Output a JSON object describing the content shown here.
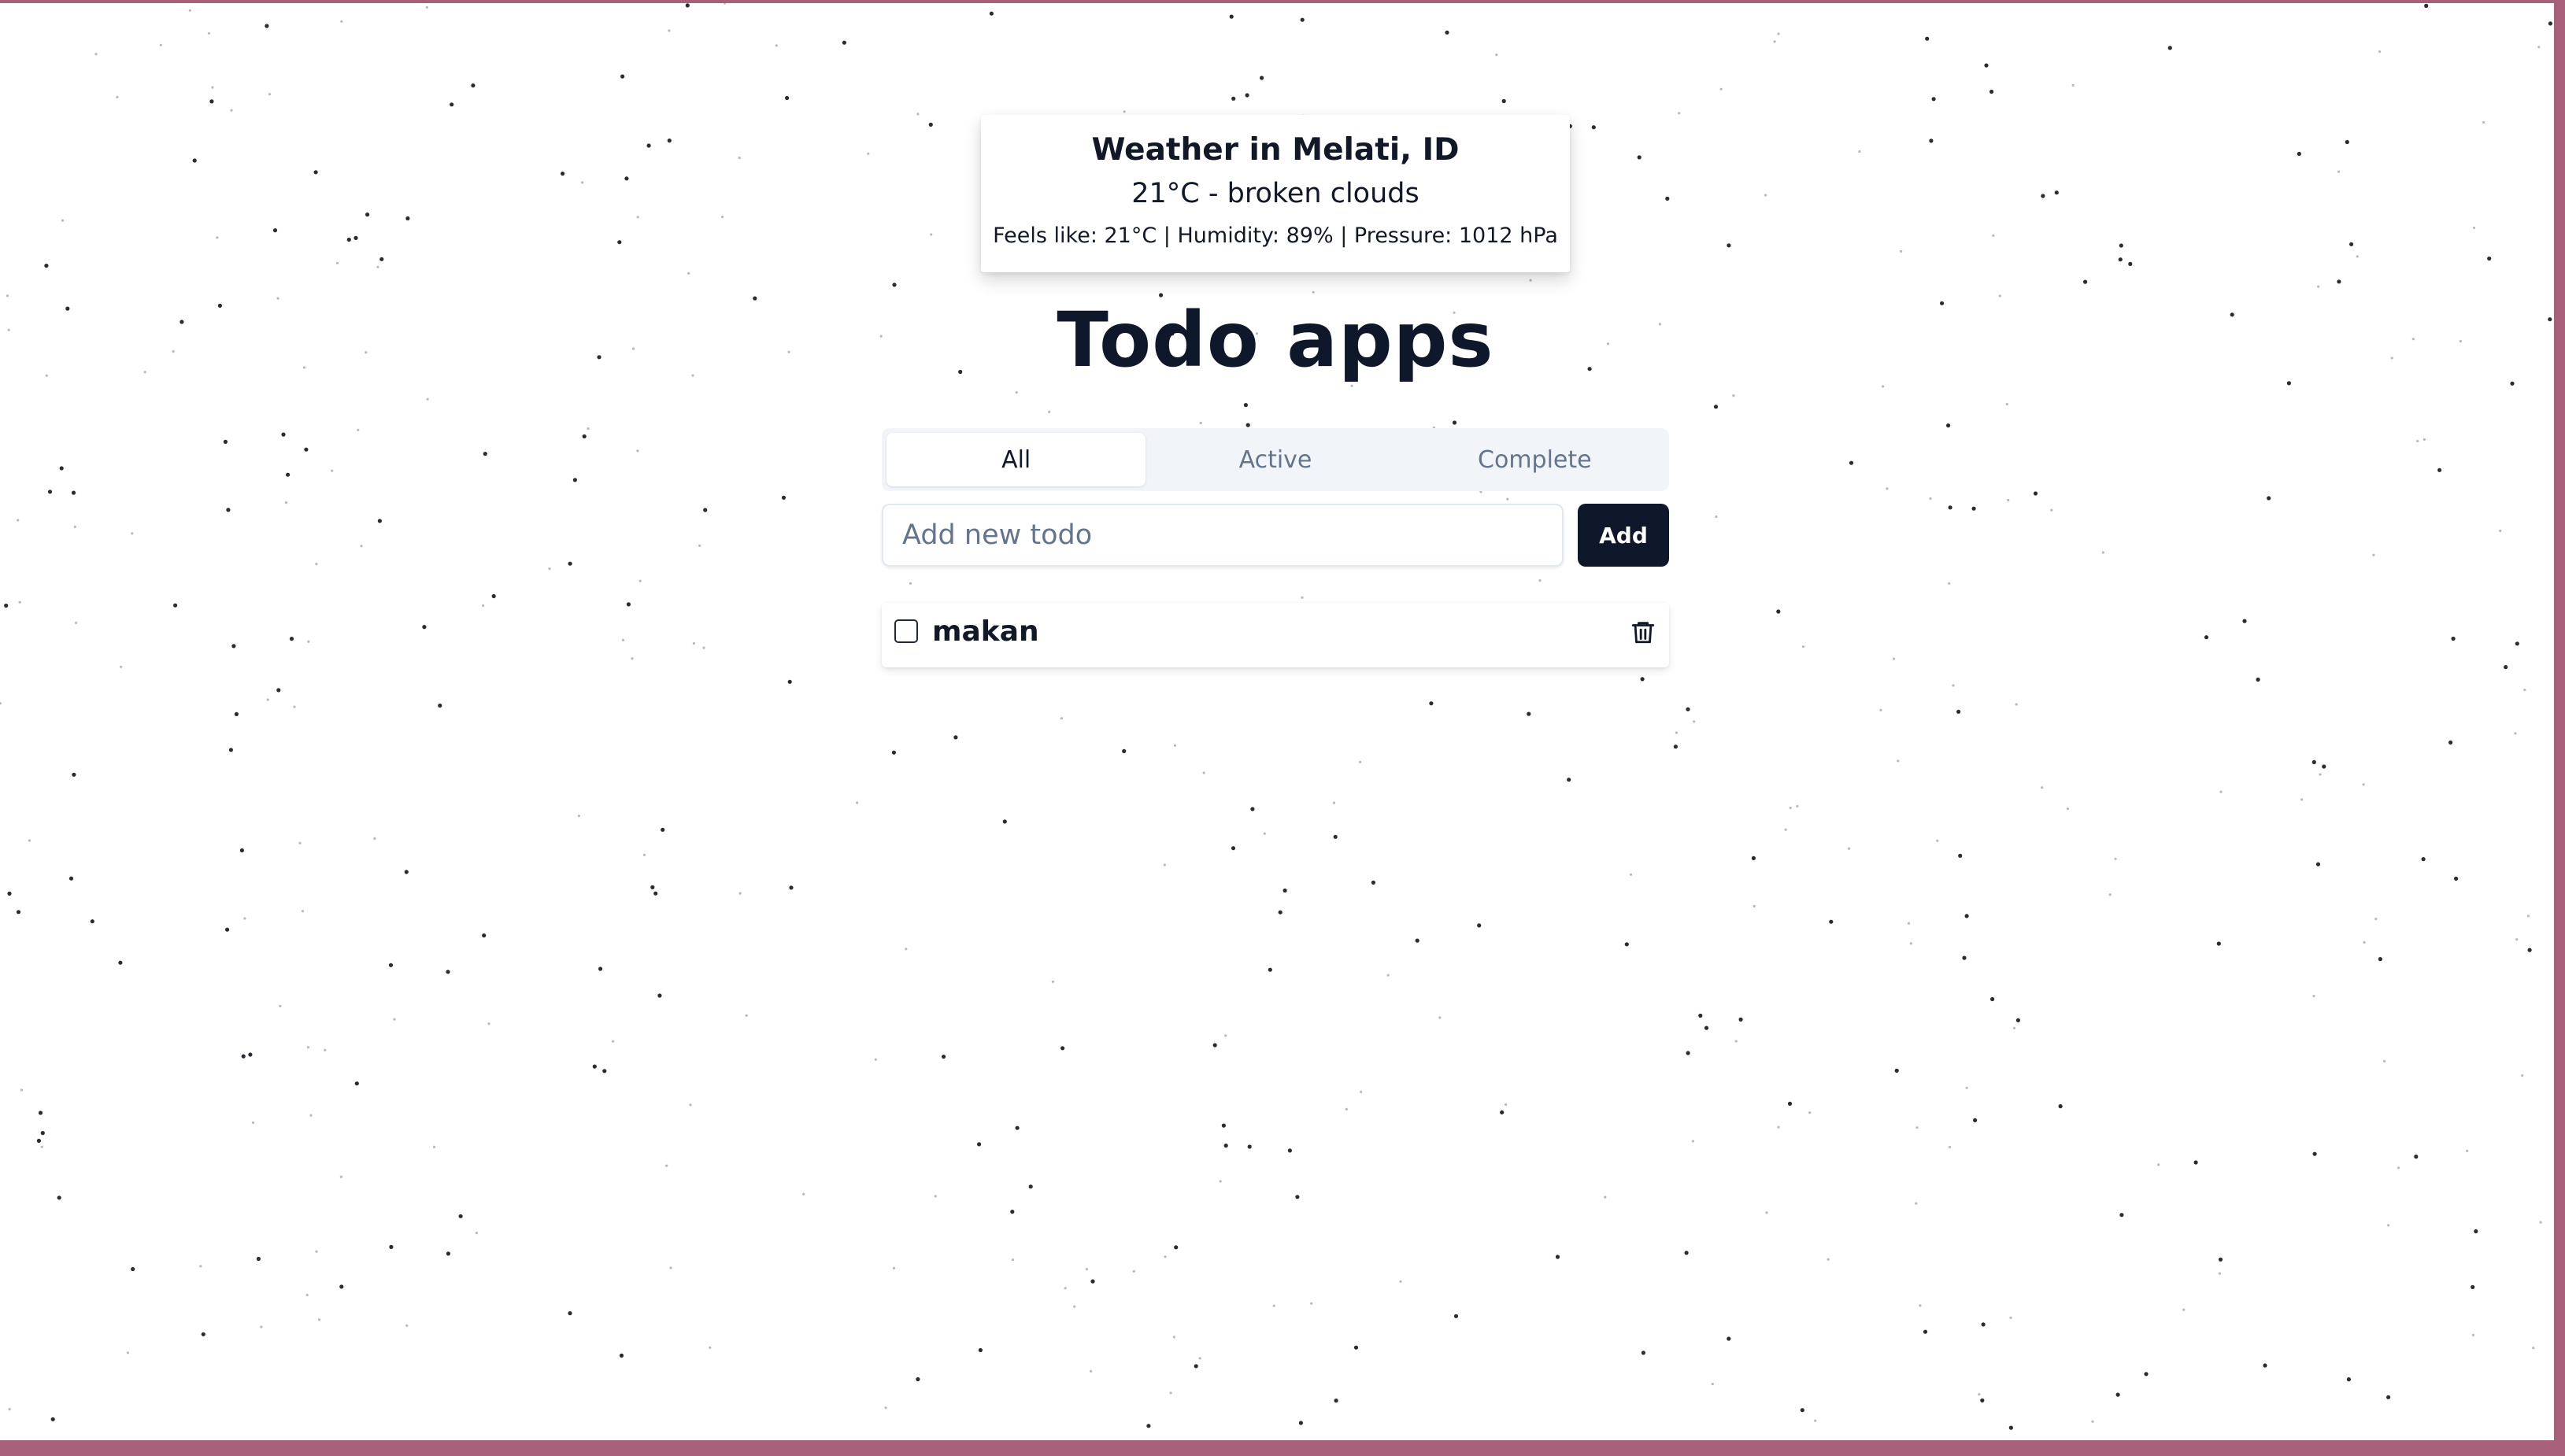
{
  "weather": {
    "title": "Weather in Melati, ID",
    "summary": "21°C - broken clouds",
    "details": "Feels like: 21°C | Humidity: 89% | Pressure: 1012 hPa"
  },
  "app": {
    "title": "Todo apps"
  },
  "filters": {
    "tabs": [
      {
        "label": "All",
        "active": true
      },
      {
        "label": "Active",
        "active": false
      },
      {
        "label": "Complete",
        "active": false
      }
    ]
  },
  "new_todo": {
    "placeholder": "Add new todo",
    "value": "",
    "add_label": "Add"
  },
  "todos": [
    {
      "text": "makan",
      "completed": false
    }
  ],
  "colors": {
    "page_frame": "#a8607a",
    "accent_dark": "#0f172a",
    "tab_bar": "#f1f5f9"
  },
  "icons": {
    "delete": "trash-icon"
  }
}
